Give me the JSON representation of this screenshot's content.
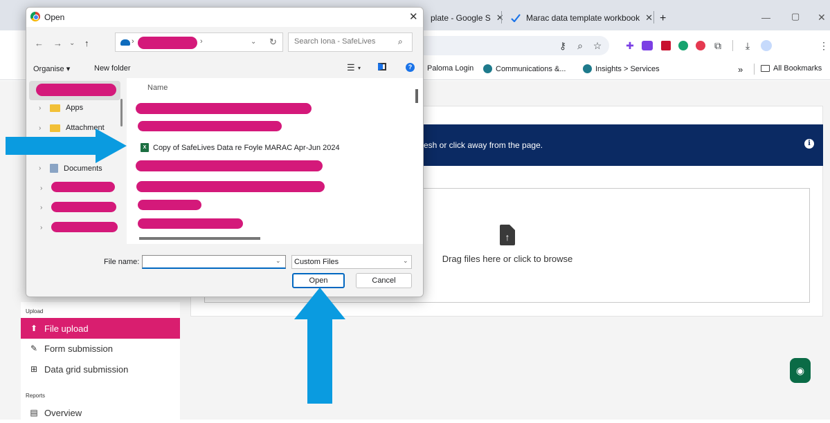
{
  "browser": {
    "tabs": [
      {
        "label": "plate - Google S",
        "close": "✕"
      },
      {
        "label": "Marac data template workbook",
        "close": "✕"
      }
    ],
    "new_tab": "+",
    "window_controls": {
      "minimize": "—",
      "restore": "▢",
      "close": "✕"
    },
    "bookmarks": [
      {
        "label": "Paloma Login"
      },
      {
        "label": "Communications &..."
      },
      {
        "label": "Insights > Services"
      }
    ],
    "bookmarks_overflow": "»",
    "all_bookmarks": "All Bookmarks"
  },
  "page": {
    "banner_text": "resh or click away from the page.",
    "dropzone_text": "Drag files here or click to browse",
    "sidebar": {
      "upload_heading": "Upload",
      "items": [
        {
          "label": "File upload",
          "icon": "file-upload-icon",
          "active": true
        },
        {
          "label": "Form submission",
          "icon": "edit-icon",
          "active": false
        },
        {
          "label": "Data grid submission",
          "icon": "grid-icon",
          "active": false
        }
      ],
      "reports_heading": "Reports",
      "reports_items": [
        {
          "label": "Overview",
          "icon": "document-icon"
        }
      ]
    }
  },
  "dialog": {
    "title": "Open",
    "search_placeholder": "Search Iona - SafeLives",
    "organise": "Organise ▾",
    "new_folder": "New folder",
    "tree": [
      {
        "label": "Apps",
        "icon": "folder-icon"
      },
      {
        "label": "Attachment",
        "icon": "folder-icon"
      },
      {
        "label": "Documents",
        "icon": "documents-icon"
      }
    ],
    "column_header": "Name",
    "visible_file": "Copy of SafeLives Data re Foyle MARAC Apr-Jun 2024",
    "file_name_label": "File name:",
    "file_name_value": "",
    "file_type": "Custom Files",
    "open_button": "Open",
    "cancel_button": "Cancel"
  },
  "colors": {
    "accent_pink": "#d91e6f",
    "redaction": "#d4197a",
    "banner_navy": "#0b2a63",
    "annotation_arrow": "#0a9be0",
    "windows_blue": "#0067c0"
  }
}
